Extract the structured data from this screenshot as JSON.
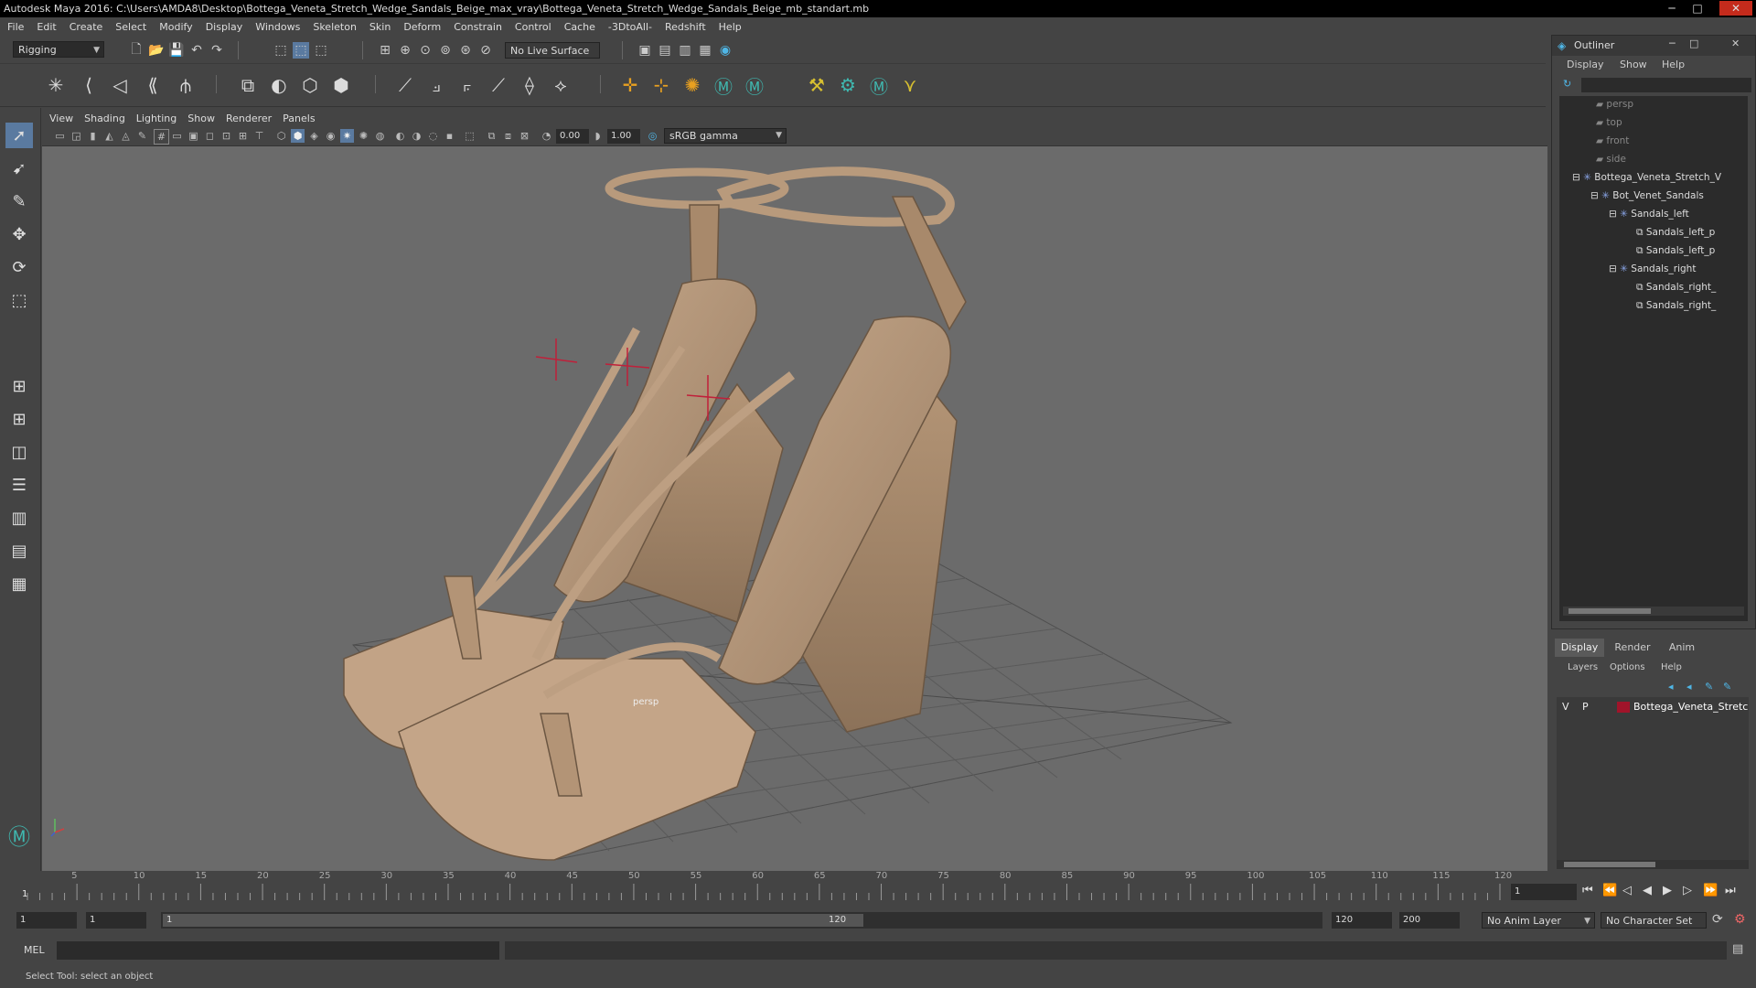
{
  "titlebar": {
    "title": "Autodesk Maya 2016: C:\\Users\\AMDA8\\Desktop\\Bottega_Veneta_Stretch_Wedge_Sandals_Beige_max_vray\\Bottega_Veneta_Stretch_Wedge_Sandals_Beige_mb_standart.mb",
    "minimize": "─",
    "maximize": "□",
    "close": "✕"
  },
  "menubar": [
    "File",
    "Edit",
    "Create",
    "Select",
    "Modify",
    "Display",
    "Windows",
    "Skeleton",
    "Skin",
    "Deform",
    "Constrain",
    "Control",
    "Cache",
    "-3DtoAll-",
    "Redshift",
    "Help"
  ],
  "shelf": {
    "mode": "Rigging",
    "live_surface": "No Live Surface"
  },
  "viewport": {
    "menu": [
      "View",
      "Shading",
      "Lighting",
      "Show",
      "Renderer",
      "Panels"
    ],
    "exposure": "0.00",
    "gamma": "1.00",
    "color_space": "sRGB gamma",
    "camera_label": "persp"
  },
  "outliner": {
    "title": "Outliner",
    "menu": [
      "Display",
      "Show",
      "Help"
    ],
    "items": [
      {
        "label": "persp",
        "type": "camera"
      },
      {
        "label": "top",
        "type": "camera"
      },
      {
        "label": "front",
        "type": "camera"
      },
      {
        "label": "side",
        "type": "camera"
      },
      {
        "label": "Bottega_Veneta_Stretch_V",
        "type": "joint"
      },
      {
        "label": "Bot_Venet_Sandals",
        "type": "joint"
      },
      {
        "label": "Sandals_left",
        "type": "joint"
      },
      {
        "label": "Sandals_left_p",
        "type": "mesh"
      },
      {
        "label": "Sandals_left_p",
        "type": "mesh"
      },
      {
        "label": "Sandals_right",
        "type": "joint"
      },
      {
        "label": "Sandals_right_",
        "type": "mesh"
      },
      {
        "label": "Sandals_right_",
        "type": "mesh"
      }
    ]
  },
  "layers": {
    "tabs": [
      "Display",
      "Render",
      "Anim"
    ],
    "menu": [
      "Layers",
      "Options",
      "Help"
    ],
    "row": {
      "v": "V",
      "p": "P",
      "name": "Bottega_Veneta_Stretc",
      "color": "#a0142a"
    }
  },
  "timeline": {
    "ticks": [
      "5",
      "10",
      "15",
      "20",
      "25",
      "30",
      "35",
      "40",
      "45",
      "50",
      "55",
      "60",
      "65",
      "70",
      "75",
      "80",
      "85",
      "90",
      "95",
      "100",
      "105",
      "110",
      "115",
      "120"
    ],
    "start_marker": "1",
    "current_frame": "1"
  },
  "range": {
    "start": "1",
    "anim_start": "1",
    "slider_start": "1",
    "slider_end": "120",
    "end": "120",
    "anim_end": "200",
    "anim_layer": "No Anim Layer",
    "character_set": "No Character Set"
  },
  "mel": {
    "label": "MEL"
  },
  "help": {
    "text": "Select Tool: select an object"
  }
}
